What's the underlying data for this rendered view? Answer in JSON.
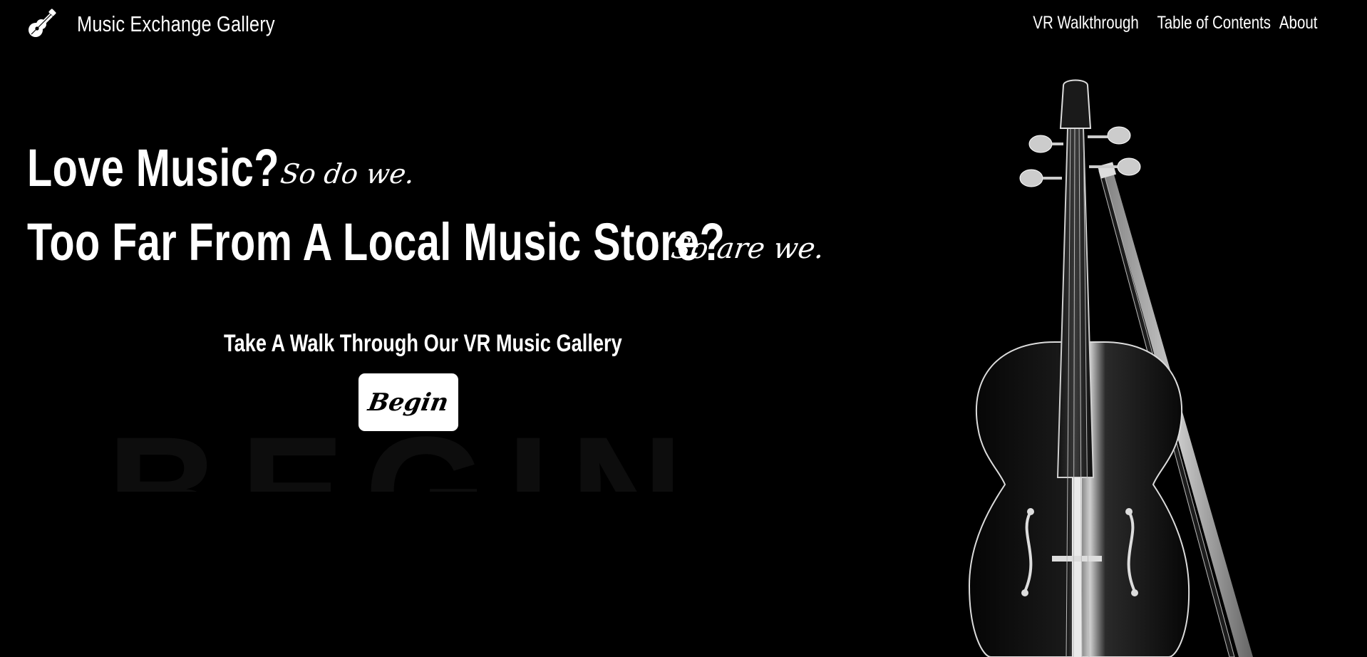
{
  "brand": {
    "name": "Music Exchange Gallery",
    "logo_icon": "guitar-icon"
  },
  "nav": {
    "links": [
      {
        "label": "VR Walkthrough"
      },
      {
        "label": "Table of Contents"
      },
      {
        "label": "About"
      }
    ]
  },
  "hero": {
    "line1": "Love Music?",
    "line1_script": "So do we.",
    "line2": "Too Far From A Local Music Store?",
    "line2_script": "So are we.",
    "tagline": "Take A Walk Through Our VR Music Gallery",
    "button_label": "Begin",
    "background_word": "BEGIN",
    "illustration_icon": "violin-icon"
  },
  "colors": {
    "background": "#000000",
    "text": "#ffffff",
    "button_bg": "#ffffff",
    "button_text": "#000000",
    "background_word": "#0d0d0d"
  }
}
